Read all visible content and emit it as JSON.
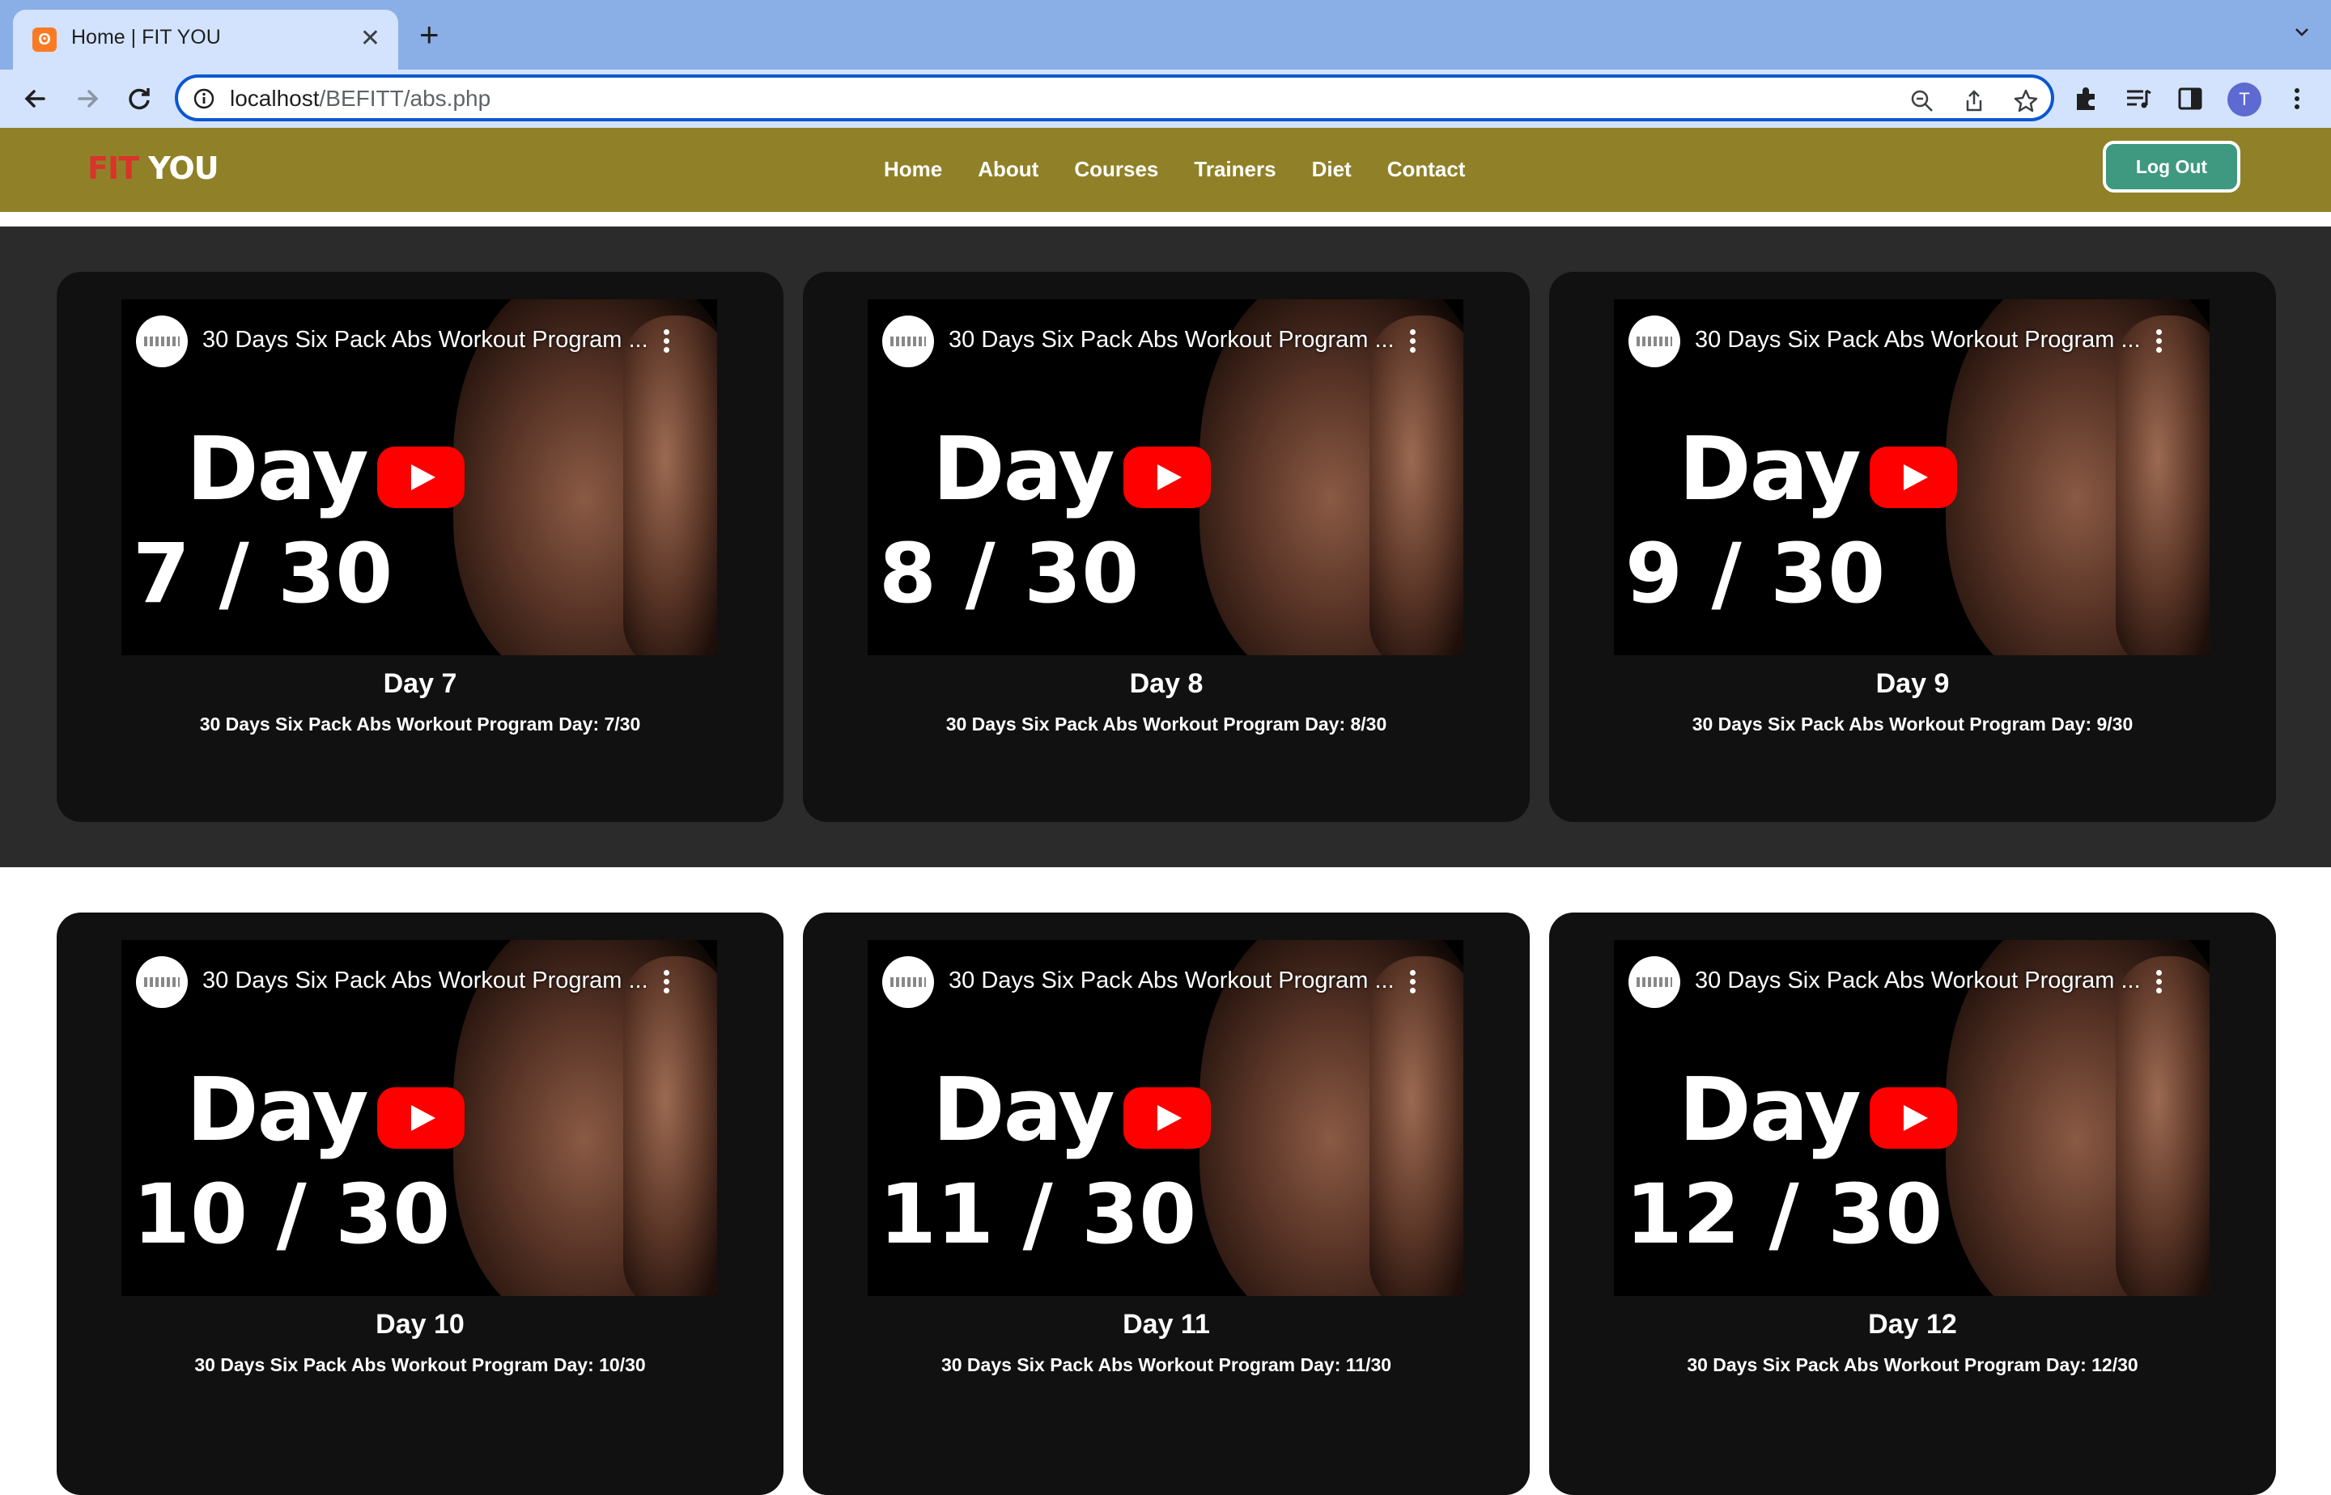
{
  "browser": {
    "tab_title": "Home | FIT YOU",
    "tab_close": "✕",
    "new_tab": "+",
    "url_host": "localhost",
    "url_path": "/BEFITT/abs.php",
    "avatar_letter": "T"
  },
  "site": {
    "brand_fit": "FIT",
    "brand_you": "YOU",
    "nav": [
      "Home",
      "About",
      "Courses",
      "Trainers",
      "Diet",
      "Contact"
    ],
    "logout_label": "Log Out",
    "accent_color": "#908128",
    "brand_red": "#d8342a",
    "logout_color": "#3f9880"
  },
  "video_title": "30 Days Six Pack Abs Workout Program ...",
  "video_day_word": "Day",
  "cards": [
    {
      "thumb_count": "7 / 30",
      "title": "Day 7",
      "text": "30 Days Six Pack Abs Workout Program Day: 7/30"
    },
    {
      "thumb_count": "8 / 30",
      "title": "Day 8",
      "text": "30 Days Six Pack Abs Workout Program Day: 8/30"
    },
    {
      "thumb_count": "9 / 30",
      "title": "Day 9",
      "text": "30 Days Six Pack Abs Workout Program Day: 9/30"
    },
    {
      "thumb_count": "10 / 30",
      "title": "Day 10",
      "text": "30 Days Six Pack Abs Workout Program Day: 10/30"
    },
    {
      "thumb_count": "11 / 30",
      "title": "Day 11",
      "text": "30 Days Six Pack Abs Workout Program Day: 11/30"
    },
    {
      "thumb_count": "12 / 30",
      "title": "Day 12",
      "text": "30 Days Six Pack Abs Workout Program Day: 12/30"
    }
  ]
}
